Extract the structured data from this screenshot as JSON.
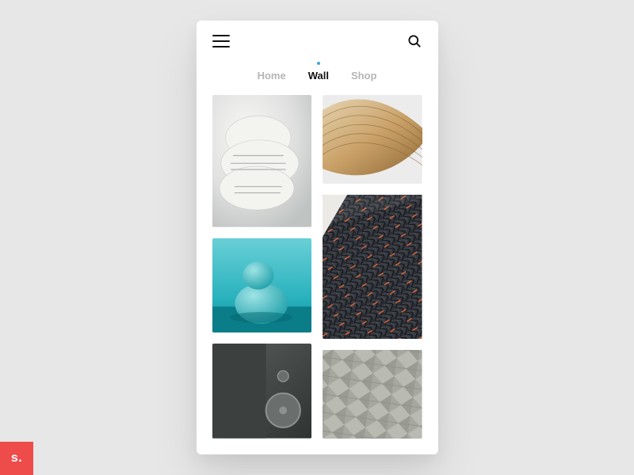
{
  "tabs": {
    "items": [
      {
        "label": "Home",
        "active": false
      },
      {
        "label": "Wall",
        "active": true
      },
      {
        "label": "Shop",
        "active": false
      }
    ]
  },
  "grid": {
    "left": [
      {
        "name": "white-foam-texture"
      },
      {
        "name": "teal-pebble-stack"
      },
      {
        "name": "grey-speaker-buttons"
      }
    ],
    "right": [
      {
        "name": "wood-wave-curve"
      },
      {
        "name": "dark-quilted-orange-stitch"
      },
      {
        "name": "grey-woven-tiles"
      }
    ]
  },
  "brand": {
    "label": "s."
  },
  "colors": {
    "accent": "#3aa7e0"
  }
}
